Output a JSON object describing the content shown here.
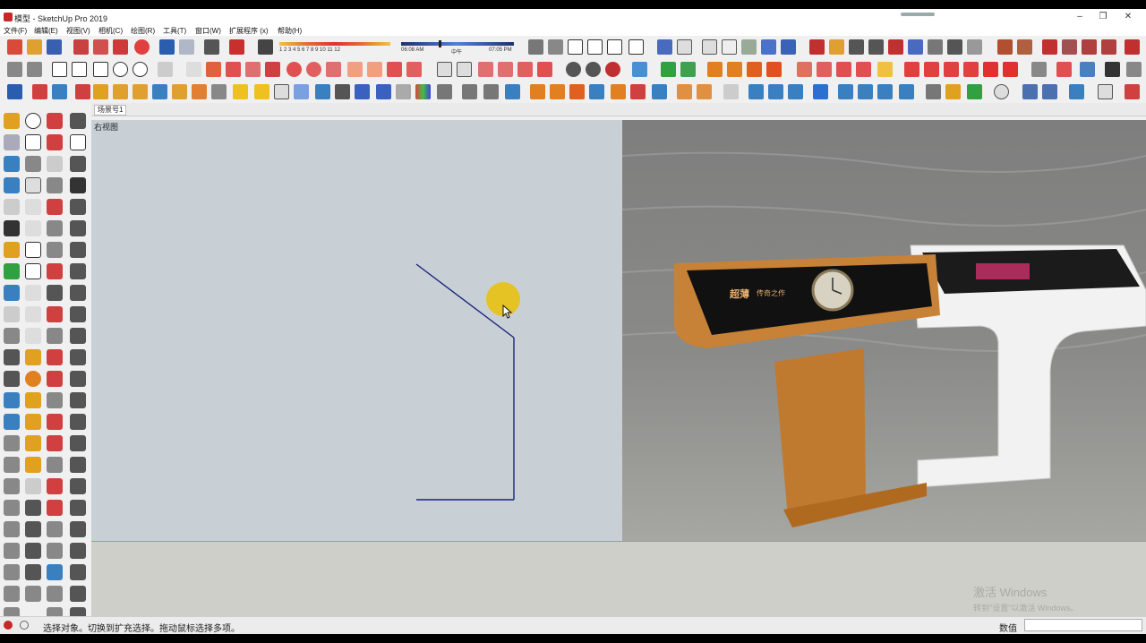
{
  "window": {
    "title": "模型 - SketchUp Pro 2019"
  },
  "menu": [
    "文件(F)",
    "编辑(E)",
    "视图(V)",
    "相机(C)",
    "绘图(R)",
    "工具(T)",
    "窗口(W)",
    "扩展程序 (x)",
    "帮助(H)"
  ],
  "shadow_bar": {
    "months": "1 2 3 4 5 6 7 8 9 10 11 12",
    "time_start": "06:08 AM",
    "time_mid": "中午",
    "time_end": "07:05 PM"
  },
  "scene": {
    "tab": "场景号1"
  },
  "viewport": {
    "view_label": "右视图"
  },
  "watermark": {
    "line1": "激活 Windows",
    "line2": "转到\"设置\"以激活 Windows。"
  },
  "status": {
    "message": "选择对象。切换到扩充选择。拖动鼠标选择多项。",
    "vcb_label": "数值",
    "vcb_value": ""
  },
  "colors": {
    "accent_blue": "#2a5db0",
    "highlight_yellow": "#e8c21a",
    "edge_blue": "#1a237e",
    "ground_line": "#6bbf6b"
  },
  "photo": {
    "screen_left_title": "超薄",
    "screen_left_sub": "传奇之作"
  }
}
